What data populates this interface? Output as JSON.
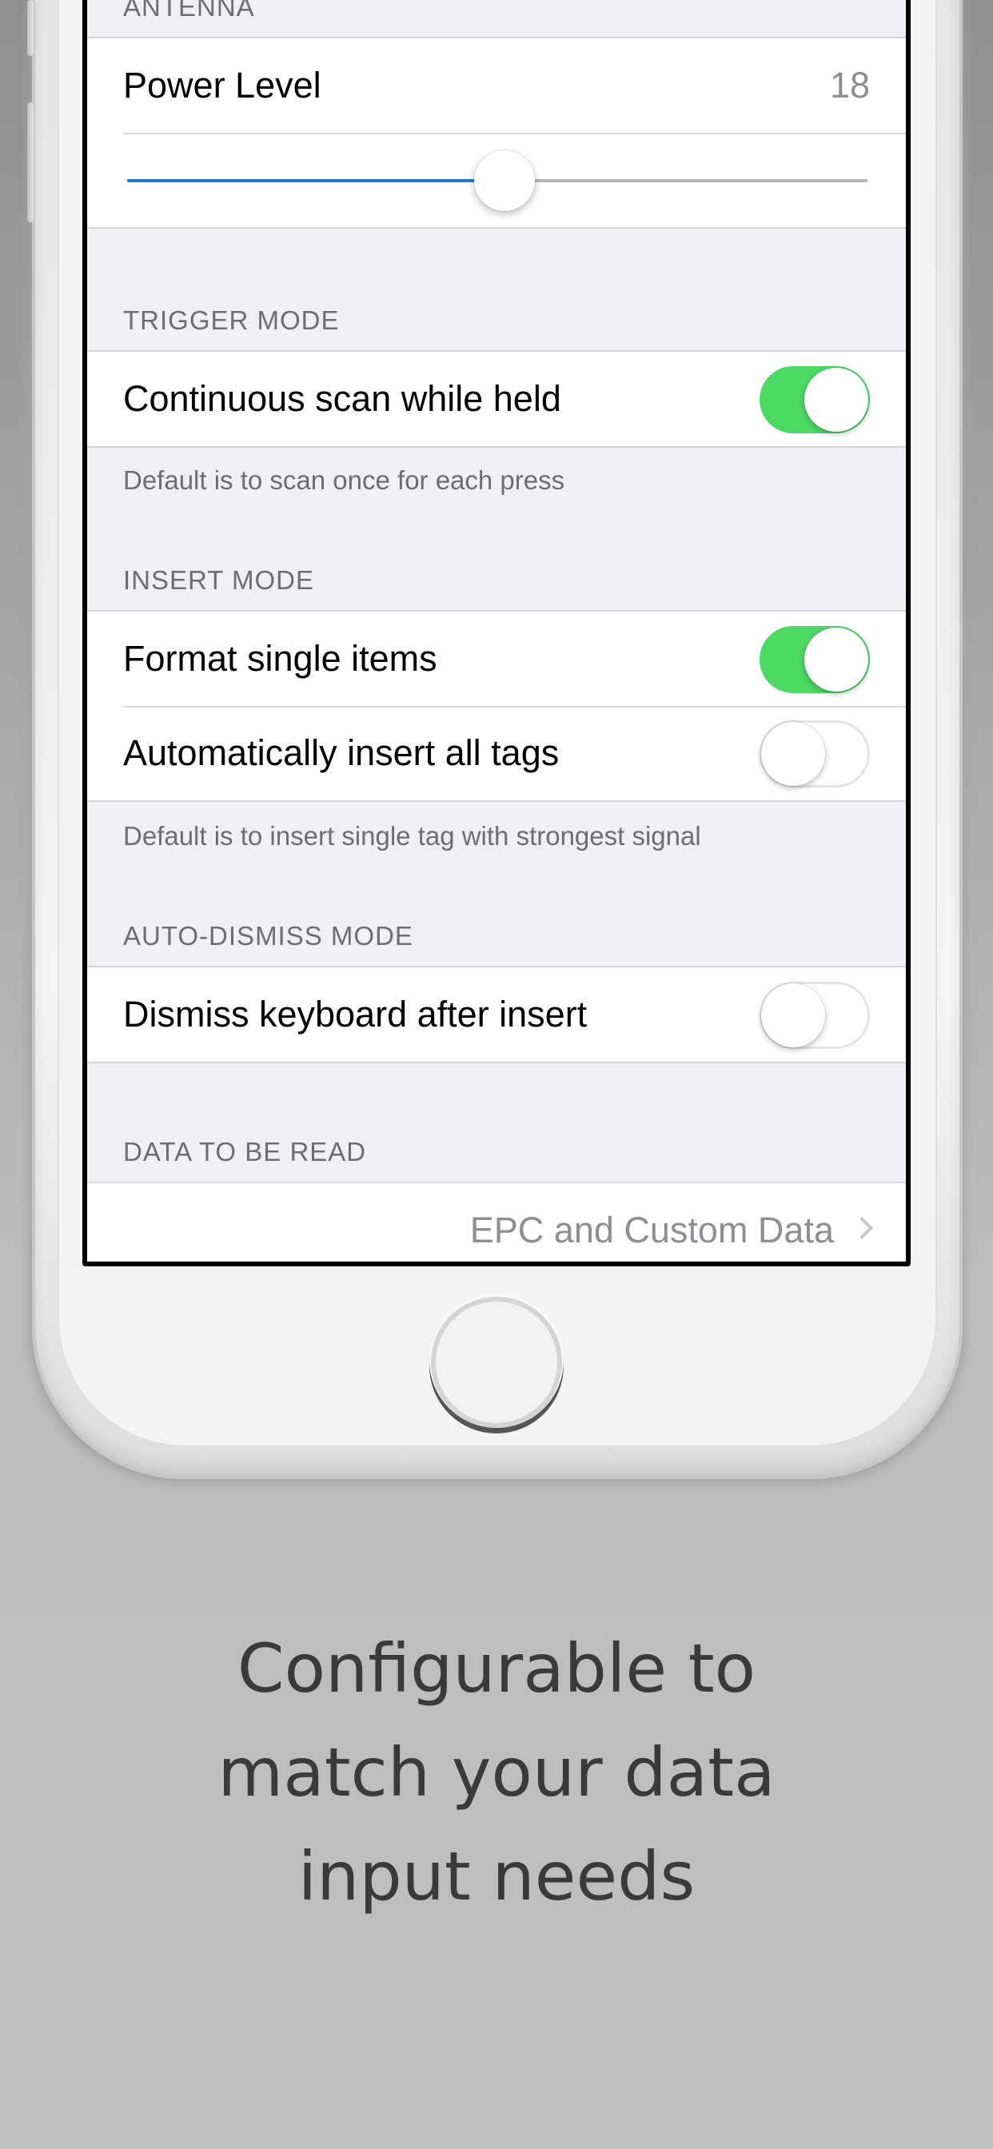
{
  "antenna": {
    "header": "ANTENNA",
    "power_level_label": "Power Level",
    "power_level_value": "18",
    "slider_fraction": 0.51
  },
  "trigger_mode": {
    "header": "TRIGGER MODE",
    "continuous_scan_label": "Continuous scan while held",
    "continuous_scan_on": true,
    "footer": "Default is to scan once for each press"
  },
  "insert_mode": {
    "header": "INSERT MODE",
    "format_single_label": "Format single items",
    "format_single_on": true,
    "auto_insert_label": "Automatically insert all tags",
    "auto_insert_on": false,
    "footer": "Default is to insert single tag with strongest signal"
  },
  "auto_dismiss": {
    "header": "AUTO-DISMISS MODE",
    "dismiss_keyboard_label": "Dismiss keyboard after insert",
    "dismiss_keyboard_on": false
  },
  "data_to_read": {
    "header": "DATA TO BE READ",
    "value": "EPC and Custom Data"
  },
  "tagline": {
    "line1": "Configurable to",
    "line2": "match your data",
    "line3": "input needs"
  },
  "colors": {
    "toggle_on": "#4cd964",
    "slider_fill": "#1f7ad6",
    "grouped_background": "#efeff4"
  }
}
